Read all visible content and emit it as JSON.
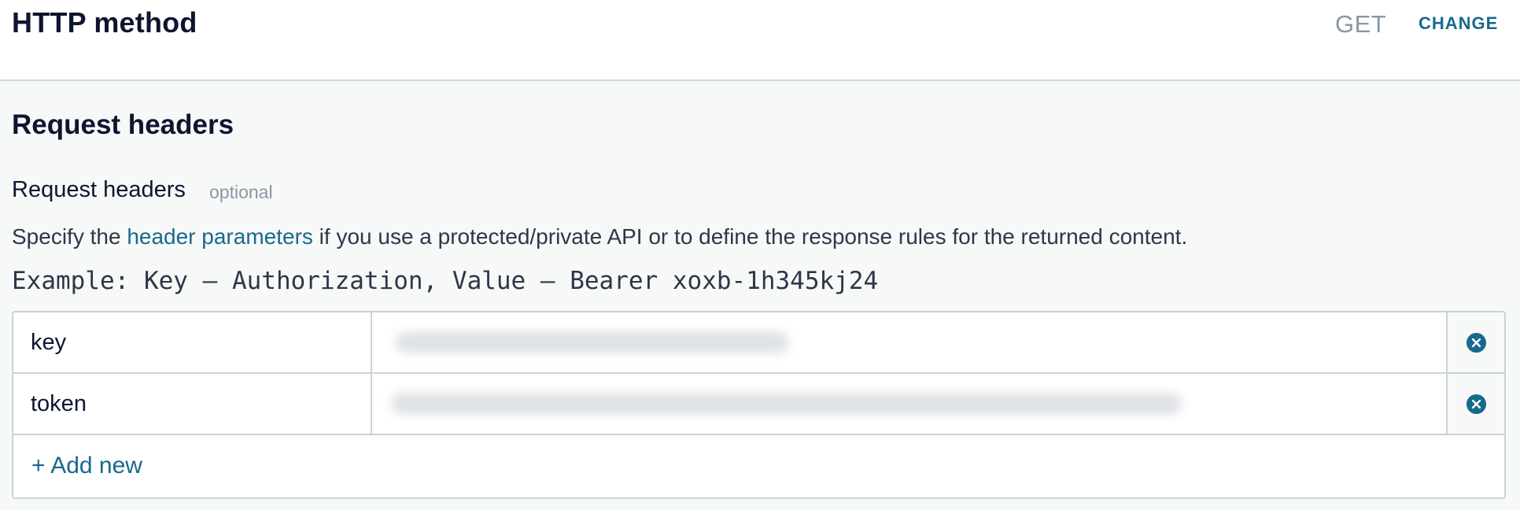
{
  "http_method": {
    "title": "HTTP method",
    "value": "GET",
    "change_label": "CHANGE"
  },
  "request_headers": {
    "section_title": "Request headers",
    "field_label": "Request headers",
    "optional_label": "optional",
    "description_prefix": "Specify the ",
    "description_link": "header parameters",
    "description_suffix": " if you use a protected/private API or to define the response rules for the returned content.",
    "example": "Example: Key — Authorization, Value — Bearer xoxb-1h345kj24",
    "rows": [
      {
        "key": "key",
        "value_icon": "blurred-value"
      },
      {
        "key": "token",
        "value_icon": "blurred-value"
      }
    ],
    "add_new_label": "+ Add new"
  },
  "colors": {
    "accent": "#176a8d",
    "title": "#0e1530",
    "muted": "#8a97a2",
    "border": "#c9d3d9",
    "section_background": "#f7f8f8"
  }
}
